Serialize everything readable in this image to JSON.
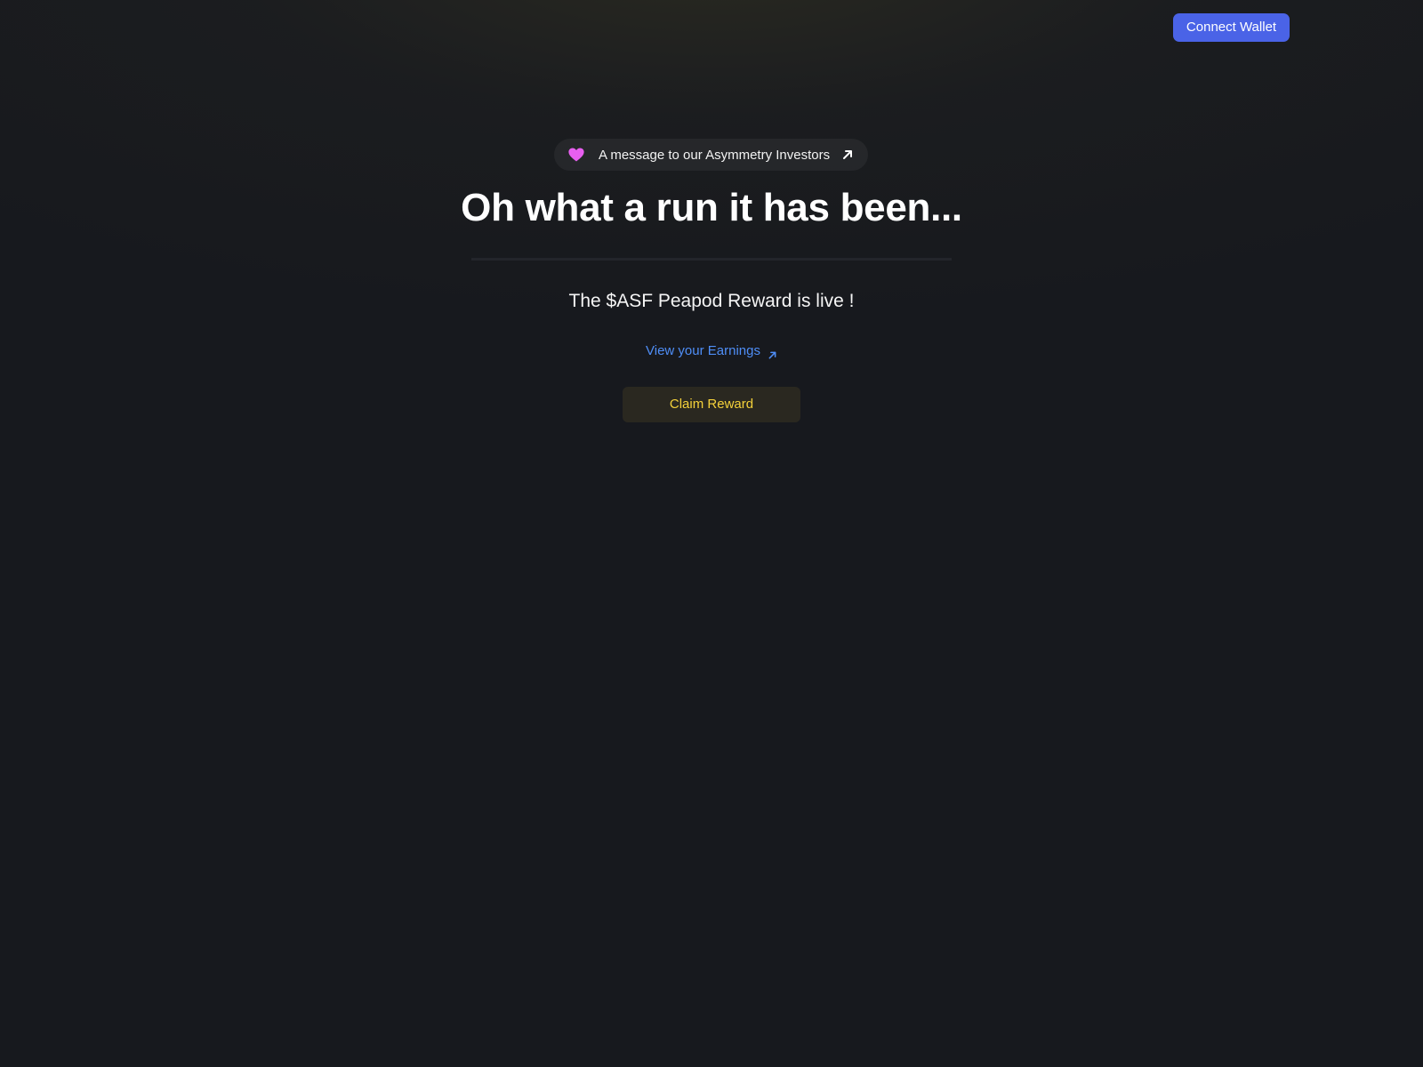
{
  "header": {
    "connect_wallet_label": "Connect Wallet"
  },
  "announcement": {
    "text": "A message to our Asymmetry Investors",
    "icon": "heart-icon",
    "icon_color": "#e85ff0",
    "action_icon": "arrow-up-right-icon"
  },
  "hero": {
    "title": "Oh what a run it has been...",
    "subtitle": "The $ASF Peapod Reward is live !",
    "earnings_link_label": "View your Earnings",
    "earnings_link_icon": "arrow-up-right-icon",
    "claim_button_label": "Claim Reward"
  },
  "colors": {
    "background": "#17191e",
    "accent_blue": "#4a63e7",
    "link_blue": "#4f8ef7",
    "claim_text": "#f4d13a",
    "heart_pink": "#e85ff0"
  }
}
